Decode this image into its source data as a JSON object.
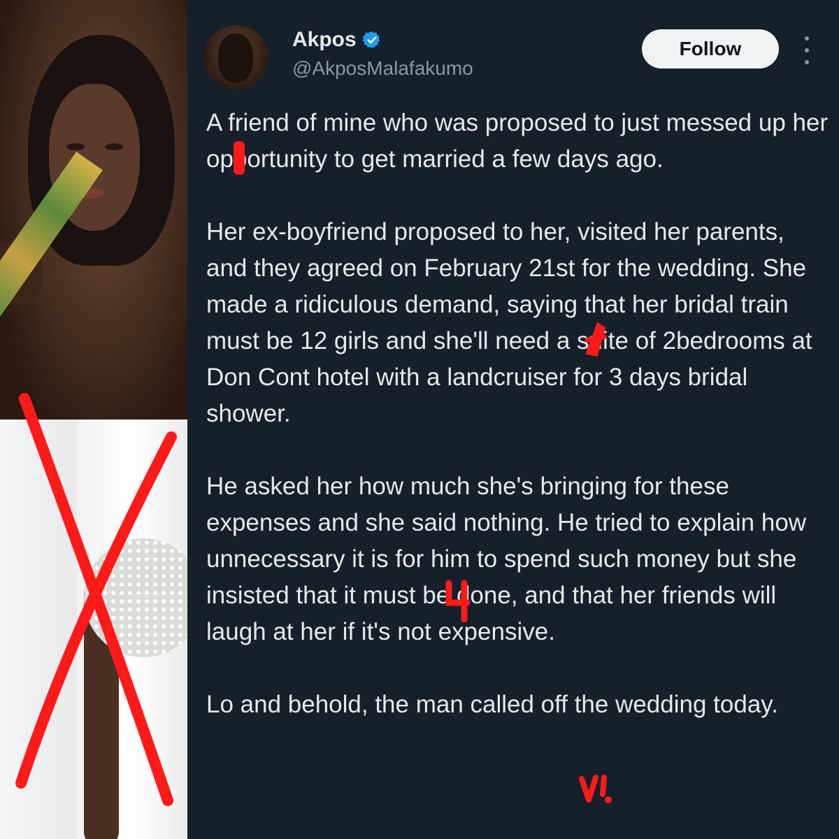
{
  "tweet": {
    "display_name": "Akpos",
    "handle": "@AkposMalafakumo",
    "follow_label": "Follow",
    "paragraphs": [
      "A friend of mine who was proposed to just messed up her opportunity to get married a few days ago.",
      "Her ex-boyfriend proposed to her, visited her parents, and they agreed on February 21st for the wedding. She made a ridiculous demand, saying that her bridal train must be 12 girls and she'll need a suite of 2bedrooms at Don Cont hotel with a landcruiser for 3 days bridal shower.",
      "He asked her how much she's bringing for these expenses and she said nothing. He tried to explain how unnecessary it is for him to spend such money but she insisted that it must be done, and that her friends will laugh at her if it's not expensive.",
      "Lo and behold, the man called off the wedding today."
    ]
  },
  "icons": {
    "verified": "verified-badge-icon",
    "more": "more-options-icon"
  },
  "colors": {
    "background": "#15202b",
    "text": "#e7e9ea",
    "secondary_text": "#8b98a5",
    "verified_blue": "#1d9bf0",
    "follow_bg": "#eff3f4",
    "annotation_red": "#ff1a1a"
  }
}
